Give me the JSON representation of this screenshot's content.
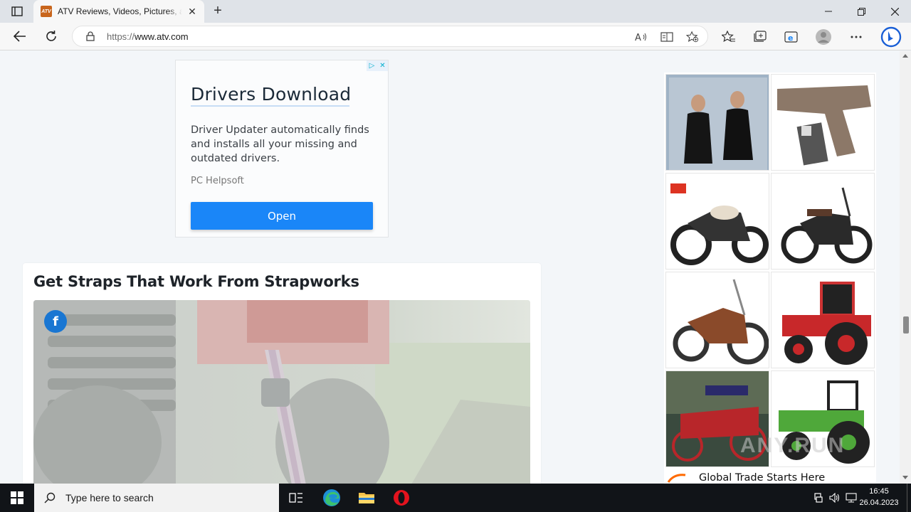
{
  "browser": {
    "tab_title": "ATV Reviews, Videos, Pictures, and",
    "favicon_text": "ATV",
    "url_protocol": "https://",
    "url_host": "www.atv.com",
    "new_tab_symbol": "+",
    "tab_close_symbol": "✕"
  },
  "top_ad": {
    "title": "Drivers Download",
    "description": "Driver Updater automatically finds and installs all your missing and outdated drivers.",
    "advertiser": "PC Helpsoft",
    "cta": "Open"
  },
  "article": {
    "title": "Get Straps That Work From Strapworks",
    "share_icon_letter": "f"
  },
  "side_ad": {
    "footer_text": "Global Trade Starts Here",
    "thumbnails": [
      "dress-photo",
      "pistol-usb-drive-photo",
      "honda-motorcycle-photo",
      "classic-motorcycle-photo",
      "chopper-motorcycle-photo",
      "red-tractor-photo",
      "horse-carriage-photo",
      "green-tractor-photo"
    ]
  },
  "watermark": "ANY.RUN",
  "taskbar": {
    "search_placeholder": "Type here to search",
    "time": "16:45",
    "date": "26.04.2023"
  },
  "colors": {
    "accent_blue": "#1a86f8",
    "facebook_blue": "#1976d2",
    "taskbar_bg": "#111418"
  }
}
